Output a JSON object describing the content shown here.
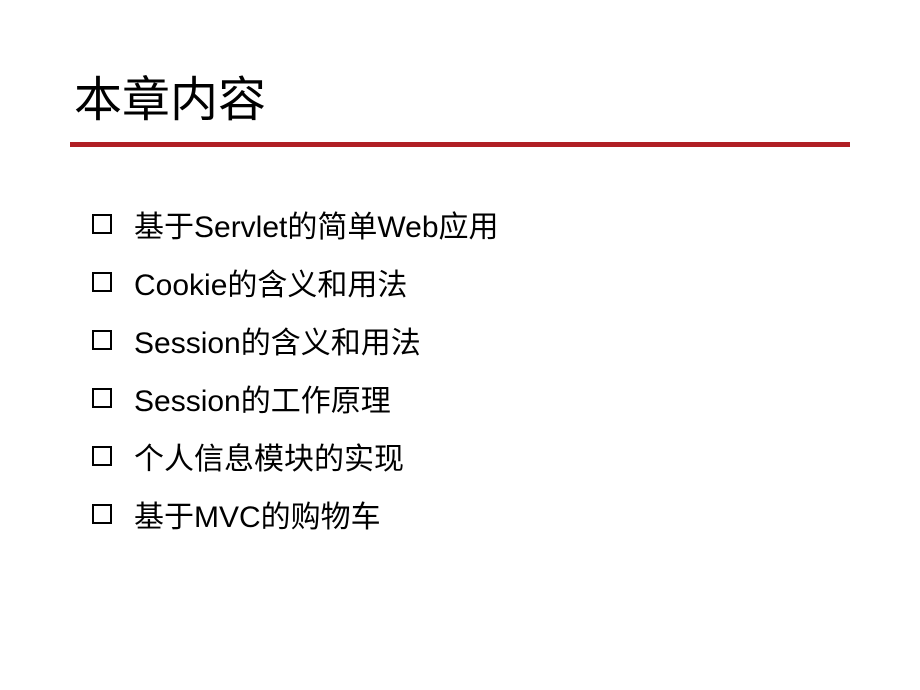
{
  "title": "本章内容",
  "items": [
    "基于Servlet的简单Web应用",
    "Cookie的含义和用法",
    "Session的含义和用法",
    "Session的工作原理",
    "个人信息模块的实现",
    "基于MVC的购物车"
  ]
}
